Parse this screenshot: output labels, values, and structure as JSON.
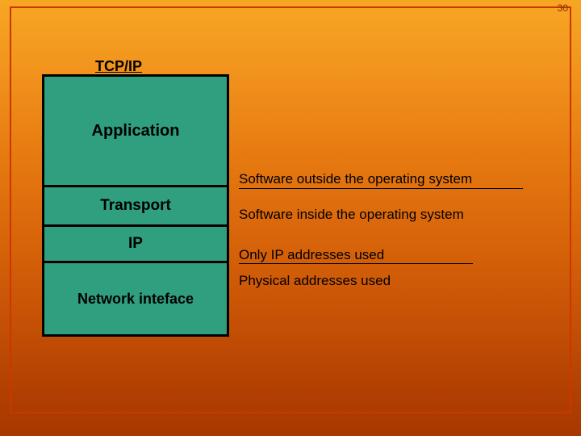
{
  "page_number": "30",
  "stack": {
    "title": "TCP/IP",
    "layers": {
      "application": "Application",
      "transport": "Transport",
      "ip": "IP",
      "network_interface": "Network inteface"
    }
  },
  "annotations": {
    "outside_os": "Software outside the operating system",
    "inside_os": "Software inside the operating system",
    "ip_addresses": "Only IP addresses used",
    "physical_addresses": "Physical addresses  used"
  }
}
